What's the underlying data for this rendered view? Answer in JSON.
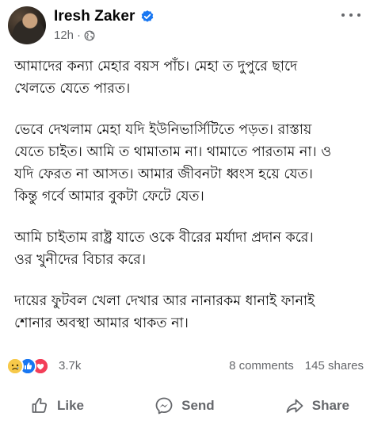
{
  "post": {
    "author": "Iresh Zaker",
    "time": "12h",
    "separator": "·",
    "paragraphs": [
      "আমাদের কন্যা মেহার বয়স পাঁচ। মেহা ত দুপুরে ছাদে\nখেলতে যেতে পারত।",
      "ভেবে দেখলাম মেহা যদি ইউনিভার্সিটিতে পড়ত। রাস্তায়\nযেতে চাইত। আমি ত থামাতাম না। থামাতে পারতাম না। ও\nযদি ফেরত না আসত। আমার জীবনটা ধ্বংস হয়ে যেত।\nকিন্তু গর্বে আমার বুকটা ফেটে যেত।",
      "আমি চাইতাম রাষ্ট্র যাতে ওকে বীরের মর্যাদা প্রদান করে।\nওর খুনীদের বিচার করে।",
      "দায়ের ফুটবল খেলা দেখার আর নানারকম ধানাই ফানাই\nশোনার অবস্থা আমার থাকত না।"
    ]
  },
  "reactions": {
    "icons": [
      "sad-reaction",
      "like-reaction",
      "love-reaction"
    ],
    "count": "3.7k",
    "comments": "8 comments",
    "shares": "145 shares"
  },
  "actions": {
    "like": "Like",
    "send": "Send",
    "share": "Share"
  },
  "colors": {
    "verified": "#1877f2",
    "secondary_text": "#65676b",
    "like": "#1877f2",
    "love": "#f33e58",
    "sad": "#f7c94a"
  }
}
